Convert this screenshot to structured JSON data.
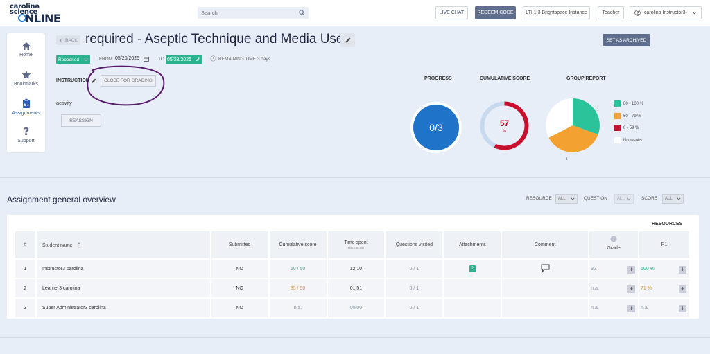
{
  "logo": {
    "line1": "carolina",
    "line2": "science",
    "line3": "NLINE"
  },
  "search": {
    "placeholder": "Search"
  },
  "topbar": {
    "live_chat": "LIVE CHAT",
    "redeem_code": "REDEEM CODE",
    "lti": "LTI 1.3 Brightspace Instance",
    "teacher": "Teacher",
    "user": "carolina Instructor3"
  },
  "nav": {
    "items": [
      {
        "label": "Home",
        "icon": "home-icon"
      },
      {
        "label": "Bookmarks",
        "icon": "star-icon"
      },
      {
        "label": "Assignments",
        "icon": "assignments-icon"
      },
      {
        "label": "Support",
        "icon": "question-icon"
      }
    ]
  },
  "header": {
    "back": "BACK",
    "title": "required - Aseptic Technique and Media Use",
    "archive": "SET AS ARCHIVED",
    "status": "Reopened",
    "from_label": "FROM",
    "from_date": "05/20/2025",
    "to_label": "TO",
    "to_date": "05/23/2025",
    "remaining": "REMAINING TIME 3 days",
    "instruction": "INSTRUCTION",
    "close_grading": "CLOSE FOR GRADING",
    "activity": "activity",
    "reassign": "REASSIGN"
  },
  "stats": {
    "progress_title": "PROGRESS",
    "progress_value": "0/3",
    "cumulative_title": "CUMULATIVE SCORE",
    "cumulative_value": "57",
    "cumulative_unit": "%",
    "cumulative_fraction": 0.57,
    "group_title": "GROUP REPORT",
    "pie_label_top": "1",
    "pie_label_bottom": "1",
    "legend": [
      {
        "label": "80 - 100 %",
        "color": "#2bc49a"
      },
      {
        "label": "60 - 79 %",
        "color": "#f3a232"
      },
      {
        "label": "0 - 59 %",
        "color": "#c8102e"
      },
      {
        "label": "No results",
        "color": "#ffffff"
      }
    ]
  },
  "overview": {
    "title": "Assignment general overview",
    "resource_label": "RESOURCE",
    "question_label": "QUESTION",
    "score_label": "SCORE",
    "all": "ALL",
    "resources_header": "RESOURCES",
    "columns": {
      "num": "#",
      "student": "Student name",
      "submitted": "Submitted",
      "cumulative": "Cumulative score",
      "time": "Time spent",
      "time_sub": "(hh:mm:ss)",
      "questions": "Questions visited",
      "attachments": "Attachments",
      "comment": "Comment",
      "grade": "Grade",
      "r1": "R1"
    },
    "rows": [
      {
        "num": "1",
        "name": "Instructor3 carolina",
        "submitted": "NO",
        "score": "50 / 50",
        "time": "12:10",
        "questions": "0 / 1",
        "attachments": "2",
        "grade": "32",
        "r1": "100 %"
      },
      {
        "num": "2",
        "name": "Learner3 carolina",
        "submitted": "NO",
        "score": "35 / 50",
        "time": "01:51",
        "questions": "0 / 1",
        "attachments": "",
        "grade": "n.a.",
        "r1": "71 %"
      },
      {
        "num": "3",
        "name": "Super Administrator3 carolina",
        "submitted": "NO",
        "score": "n.a.",
        "time": "00:00",
        "questions": "0 / 1",
        "attachments": "",
        "grade": "n.a.",
        "r1": "n.a."
      }
    ]
  }
}
